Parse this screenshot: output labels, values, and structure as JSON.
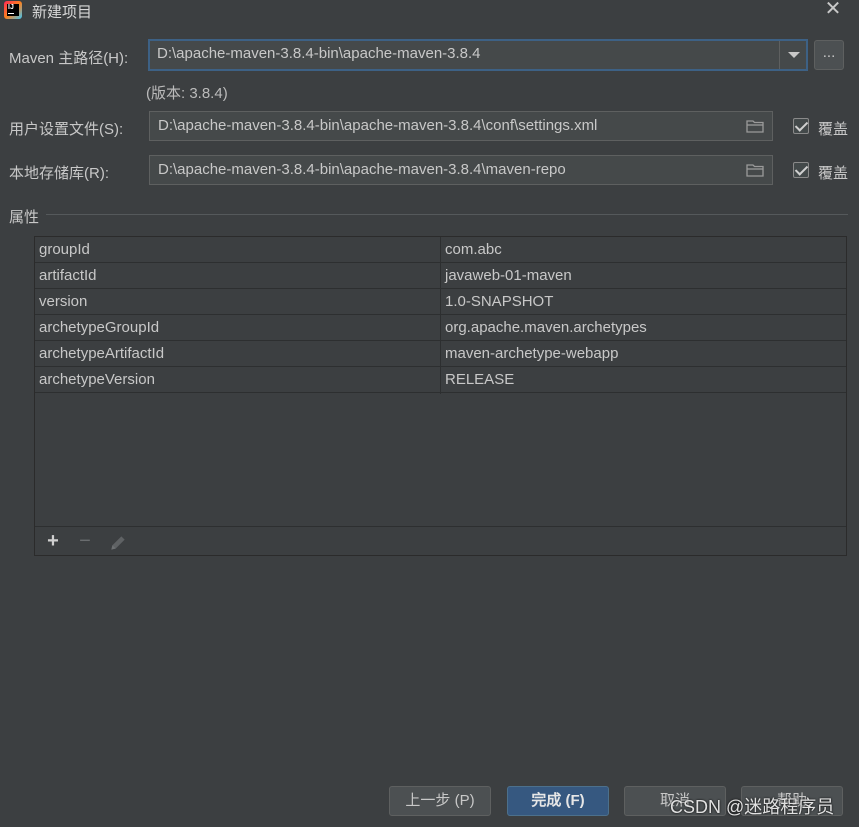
{
  "window": {
    "title": "新建项目",
    "app_icon_text": "IJ"
  },
  "maven_home": {
    "label": "Maven 主路径(H):",
    "value": "D:\\apache-maven-3.8.4-bin\\apache-maven-3.8.4",
    "browse_label": "...",
    "version_text": "(版本: 3.8.4)"
  },
  "user_settings": {
    "label": "用户设置文件(S):",
    "value": "D:\\apache-maven-3.8.4-bin\\apache-maven-3.8.4\\conf\\settings.xml",
    "override_label": "覆盖",
    "override_checked": true
  },
  "local_repo": {
    "label": "本地存储库(R):",
    "value": "D:\\apache-maven-3.8.4-bin\\apache-maven-3.8.4\\maven-repo",
    "override_label": "覆盖",
    "override_checked": true
  },
  "properties": {
    "section_title": "属性",
    "rows": [
      {
        "key": "groupId",
        "value": "com.abc"
      },
      {
        "key": "artifactId",
        "value": "javaweb-01-maven"
      },
      {
        "key": "version",
        "value": "1.0-SNAPSHOT"
      },
      {
        "key": "archetypeGroupId",
        "value": "org.apache.maven.archetypes"
      },
      {
        "key": "archetypeArtifactId",
        "value": "maven-archetype-webapp"
      },
      {
        "key": "archetypeVersion",
        "value": "RELEASE"
      }
    ],
    "toolbar": {
      "add": "+",
      "remove": "−",
      "edit_icon": "pencil-icon"
    }
  },
  "buttons": {
    "previous": "上一步 (P)",
    "finish": "完成 (F)",
    "cancel": "取消",
    "help": "帮助"
  },
  "watermark": "CSDN @迷路程序员",
  "colors": {
    "background": "#3c3f41",
    "primary_button": "#365880",
    "focus_border": "#3d6185"
  }
}
